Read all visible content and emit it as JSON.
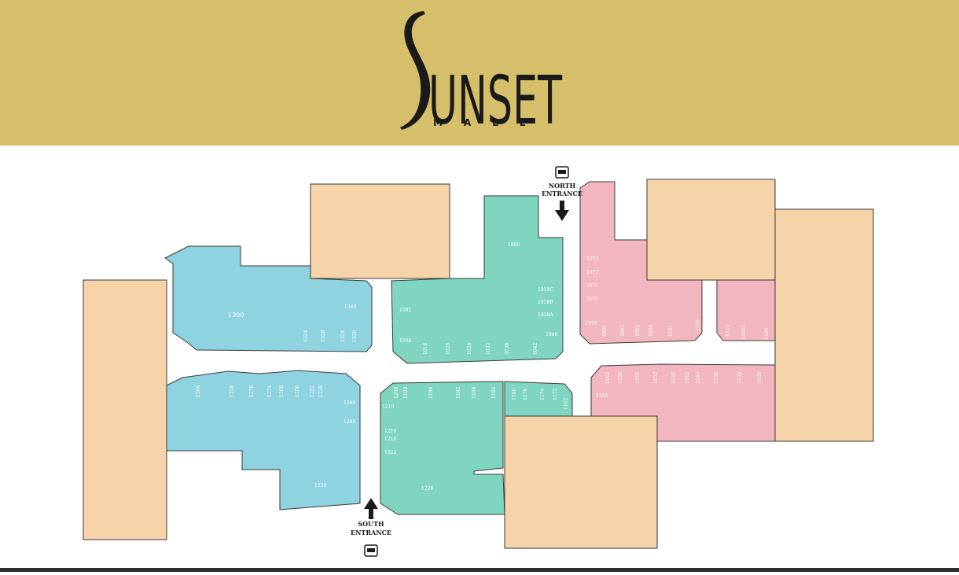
{
  "header": {
    "logo_word": "SUNSET",
    "logo_sub": "MALL",
    "background": "#d6bf6a"
  },
  "colors": {
    "anchor": "#f6d3a9",
    "wing_blue": "#8fd2e0",
    "wing_green": "#7fd5c0",
    "wing_pink": "#f2b6c0",
    "outline": "#3a3a3a"
  },
  "entrances": {
    "north": {
      "line1": "NORTH",
      "line2": "ENTRANCE",
      "icon": "car-icon",
      "arrow": "down"
    },
    "south": {
      "line1": "SOUTH",
      "line2": "ENTRANCE",
      "icon": "car-icon",
      "arrow": "up"
    }
  },
  "units": {
    "u1300": "1300",
    "u1348": "1348",
    "u1324": "1324",
    "u1328": "1328",
    "u1334": "1334",
    "u1338": "1338",
    "u1266": "1266",
    "u1258": "1258",
    "u1278": "1278",
    "u1274": "1274",
    "u1268": "1268",
    "u1256": "1256",
    "u1252": "1252",
    "u1238": "1238",
    "u1244": "1244",
    "u1248": "1248",
    "u1230": "1230",
    "u1066": "1066",
    "u1002": "1002",
    "u1008": "1008",
    "u1016": "1016",
    "u1020": "1020",
    "u1028": "1028",
    "u1032": "1032",
    "u1036": "1036",
    "u1042": "1042",
    "u1058C": "1058C",
    "u1058B": "1058B",
    "u1058A": "1058A",
    "u1046": "1046",
    "u1206": "1206",
    "u1198": "1198",
    "u1196": "1196",
    "u1192": "1192",
    "u1188": "1188",
    "u1186": "1186",
    "u1210": "1210",
    "u1216": "1216",
    "u1218": "1218",
    "u1222": "1222",
    "u1226": "1226",
    "u1180": "1180",
    "u1176": "1176",
    "u1174": "1174",
    "u1172": "1172",
    "u1162": "1162",
    "u1070": "1070",
    "u1072": "1072",
    "u1074": "1074",
    "u1076": "1076",
    "u1078": "1078",
    "u1086": "1086",
    "u1092": "1092",
    "u1094": "1094",
    "u1096": "1096",
    "u1102": "1102",
    "u1106": "1106",
    "u1116": "1116",
    "u1104A": "1104A",
    "u1120": "1120",
    "u1162b": "1162",
    "u1158": "1158",
    "u1154": "1154",
    "u1152": "1152",
    "u1146": "1146",
    "u1142": "1142",
    "u1140": "1140",
    "u1138": "1138",
    "u1130": "1130",
    "u1126": "1126",
    "u1164": "1164"
  }
}
